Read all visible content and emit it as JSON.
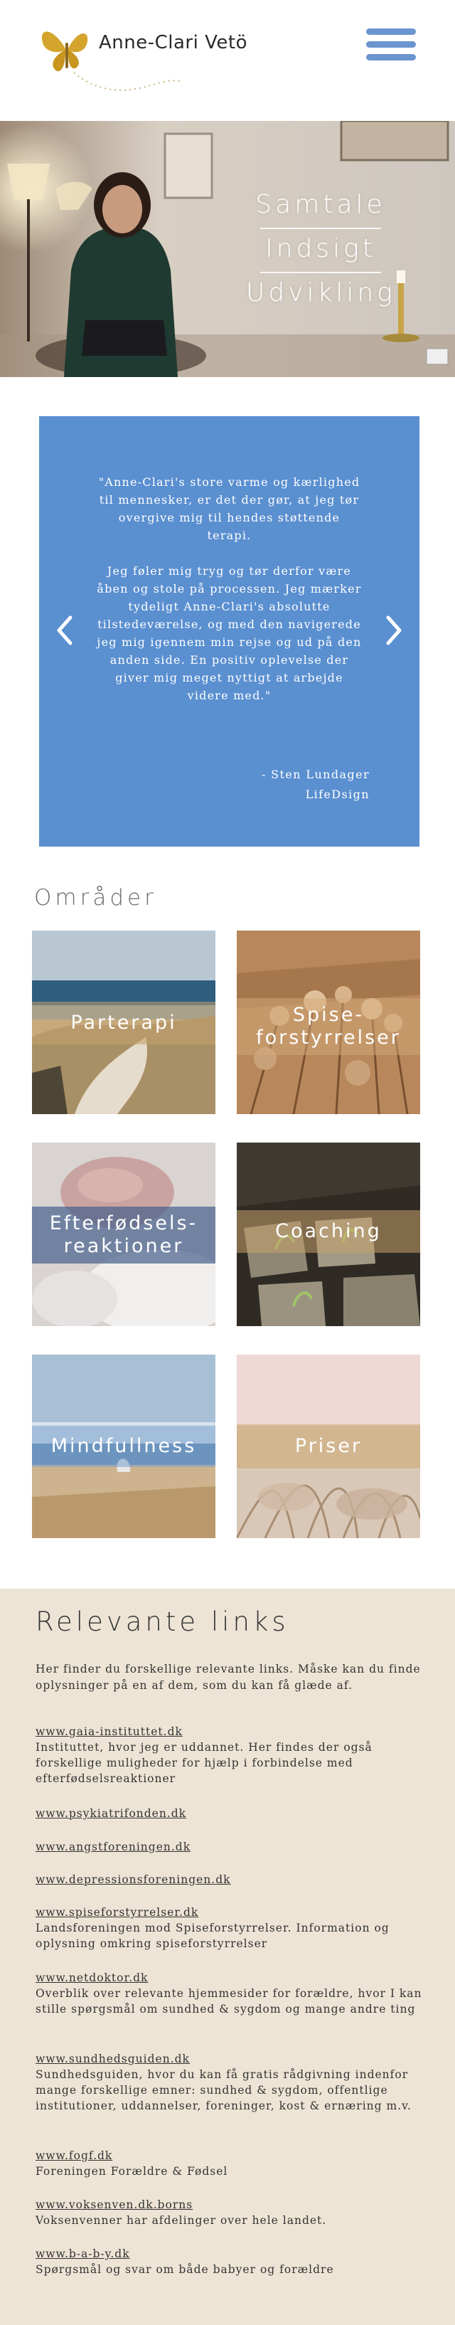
{
  "header": {
    "logo_text": "Anne-Clari Vetö",
    "menu_icon": "hamburger-menu-icon"
  },
  "hero": {
    "words": [
      "Samtale",
      "Indsigt",
      "Udvikling"
    ]
  },
  "testimonial": {
    "paragraph_1": "\"Anne-Clari's store varme og kærlighed til mennesker, er det der gør, at jeg tør overgive mig til hendes støttende terapi.",
    "paragraph_2": "Jeg føler mig tryg og tør derfor være åben og stole på processen. Jeg mærker tydeligt Anne-Clari's absolutte tilstedeværelse, og med den navigerede jeg mig igennem min rejse og ud på den anden side. En positiv oplevelse der giver mig meget nyttigt at arbejde videre med.\"",
    "author": "- Sten Lundager",
    "company": "LifeDsign",
    "prev_icon": "chevron-left-icon",
    "next_icon": "chevron-right-icon",
    "background_color": "#5a8fd0"
  },
  "areas": {
    "title": "Områder",
    "tiles": [
      {
        "label": "Parterapi"
      },
      {
        "label": "Spise-\nforstyrrelser"
      },
      {
        "label": "Efterfødsels-\nreaktioner"
      },
      {
        "label": "Coaching"
      },
      {
        "label": "Mindfullness"
      },
      {
        "label": "Priser"
      }
    ]
  },
  "links": {
    "title": "Relevante links",
    "intro": "Her finder du forskellige relevante links. Måske kan du finde oplysninger på en af dem, som du kan få glæde af.",
    "items": [
      {
        "url": "www.gaia-instituttet.dk",
        "desc": "Instituttet, hvor jeg er uddannet. Her findes der også forskellige muligheder for hjælp i forbindelse med efterfødselsreaktioner"
      },
      {
        "url": "www.psykiatrifonden.dk",
        "desc": ""
      },
      {
        "url": "www.angstforeningen.dk",
        "desc": ""
      },
      {
        "url": "www.depressionsforeningen.dk",
        "desc": ""
      },
      {
        "url": "www.spiseforstyrrelser.dk",
        "desc": "Landsforeningen mod Spiseforstyrrelser. Information og oplysning omkring spiseforstyrrelser"
      },
      {
        "url": "www.netdoktor.dk",
        "desc": "Overblik over relevante hjemmesider for forældre, hvor I kan stille spørgsmål om sundhed & sygdom og mange andre ting"
      },
      {
        "url": "www.sundhedsguiden.dk",
        "desc": "Sundhedsguiden, hvor du kan få gratis rådgivning indenfor mange forskellige emner: sundhed & sygdom, offentlige institutioner, uddannelser, foreninger, kost & ernæring m.v."
      },
      {
        "url": "www.fogf.dk",
        "desc": "Foreningen Forældre & Fødsel"
      },
      {
        "url": "www.voksenven.dk.borns",
        "desc": "Voksenvenner har afdelinger over hele landet."
      },
      {
        "url": "www.b-a-b-y.dk",
        "desc": "Spørgsmål og svar om både babyer og forældre"
      }
    ]
  },
  "colors": {
    "accent_blue": "#5a8fd0",
    "menu_blue": "#6a95cf",
    "butterfly_gold": "#d4a42c",
    "links_bg": "#ede4d5"
  }
}
